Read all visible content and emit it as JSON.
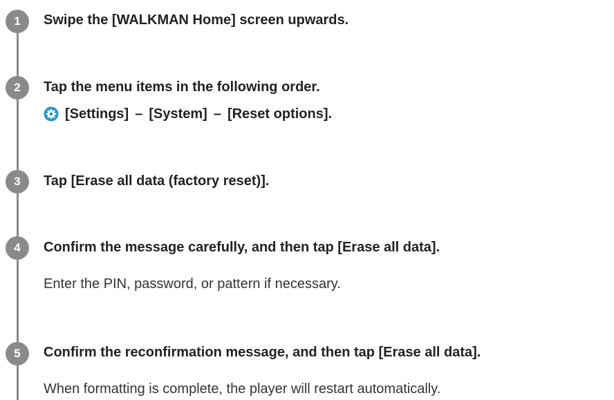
{
  "steps": [
    {
      "number": "1",
      "title": "Swipe the [WALKMAN Home] screen upwards."
    },
    {
      "number": "2",
      "title": "Tap the menu items in the following order.",
      "path": {
        "icon": "settings-gear-icon",
        "items": [
          "[Settings]",
          "[System]",
          "[Reset options]."
        ],
        "separator": "–"
      }
    },
    {
      "number": "3",
      "title": "Tap [Erase all data (factory reset)]."
    },
    {
      "number": "4",
      "title": "Confirm the message carefully, and then tap [Erase all data].",
      "note": "Enter the PIN, password, or pattern if necessary."
    },
    {
      "number": "5",
      "title": "Confirm the reconfirmation message, and then tap [Erase all data].",
      "note": "When formatting is complete, the player will restart automatically."
    }
  ],
  "colors": {
    "step_circle": "#8a8a8a",
    "gear_icon": "#2a97c8",
    "text": "#222222"
  }
}
